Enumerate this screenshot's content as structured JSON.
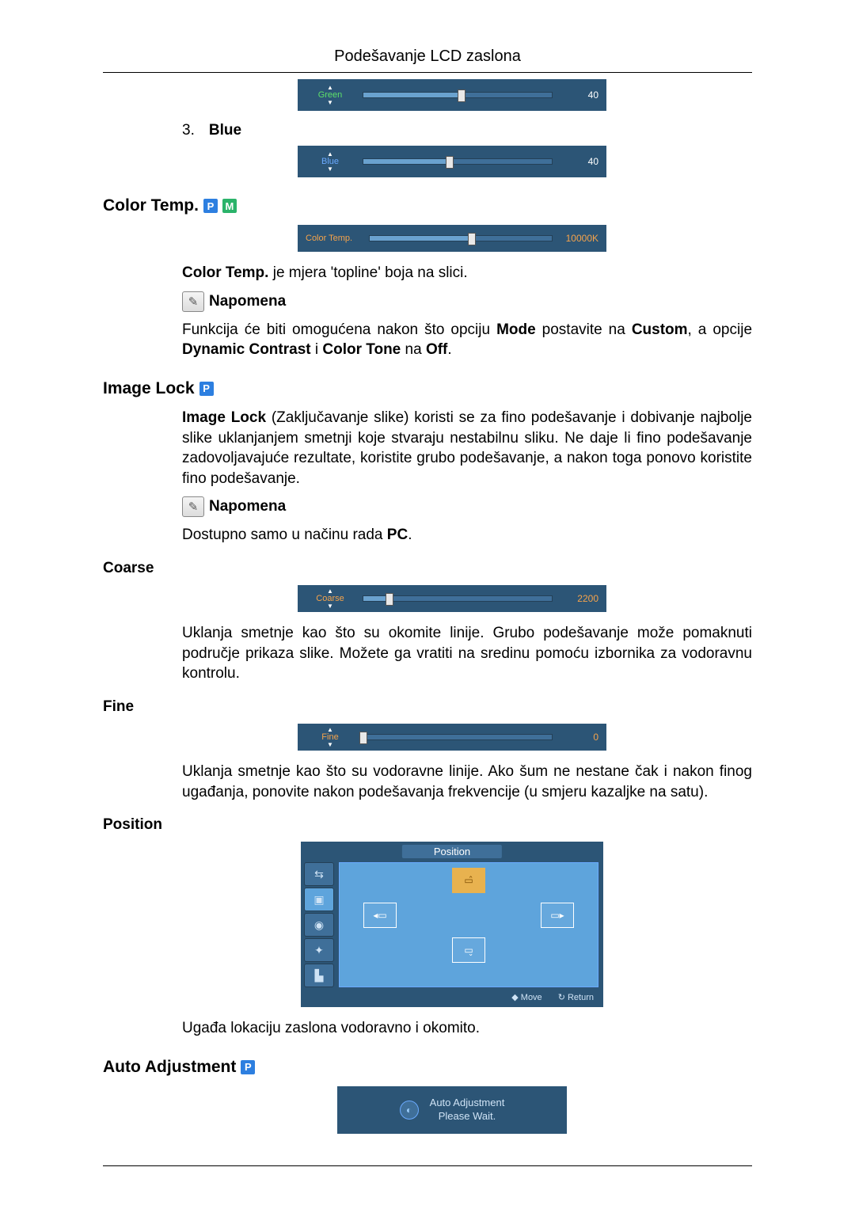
{
  "header": {
    "title": "Podešavanje LCD zaslona"
  },
  "green_slider": {
    "label": "Green",
    "value": "40",
    "percent": 52
  },
  "blue_item": {
    "num": "3.",
    "label": "Blue"
  },
  "blue_slider": {
    "label": "Blue",
    "value": "40",
    "percent": 46
  },
  "color_temp": {
    "heading": "Color Temp.",
    "slider": {
      "label": "Color Temp.",
      "value": "10000K",
      "percent": 56
    },
    "desc_prefix": "Color Temp.",
    "desc_rest": " je mjera 'topline' boja na slici.",
    "note_label": "Napomena",
    "note_text_a": "Funkcija će biti omogućena nakon što opciju ",
    "note_b1": "Mode",
    "note_mid1": " postavite na ",
    "note_b2": "Custom",
    "note_mid2": ", a opcije ",
    "note_b3": "Dynamic Contrast",
    "note_mid3": " i ",
    "note_b4": "Color Tone",
    "note_mid4": " na ",
    "note_b5": "Off",
    "note_end": "."
  },
  "image_lock": {
    "heading": "Image Lock",
    "desc_b": "Image Lock",
    "desc_rest": " (Zaključavanje slike) koristi se za fino podešavanje i dobivanje najbolje slike uklanjanjem smetnji koje stvaraju nestabilnu sliku. Ne daje li fino podešavanje zadovoljavajuće rezultate, koristite grubo podešavanje, a nakon toga ponovo koristite fino podešavanje.",
    "note_label": "Napomena",
    "note_text_a": "Dostupno samo u načinu rada ",
    "note_b1": "PC",
    "note_end": "."
  },
  "coarse": {
    "heading": "Coarse",
    "slider": {
      "label": "Coarse",
      "value": "2200",
      "percent": 14
    },
    "desc": "Uklanja smetnje kao što su okomite linije. Grubo podešavanje može pomaknuti područje prikaza slike. Možete ga vratiti na sredinu pomoću izbornika za vodoravnu kontrolu."
  },
  "fine": {
    "heading": "Fine",
    "slider": {
      "label": "Fine",
      "value": "0",
      "percent": 0
    },
    "desc": "Uklanja smetnje kao što su vodoravne linije. Ako šum ne nestane čak i nakon finog ugađanja, ponovite nakon podešavanja frekvencije (u smjeru kazaljke na satu)."
  },
  "position": {
    "heading": "Position",
    "panel_title": "Position",
    "footer_move": "Move",
    "footer_return": "Return",
    "desc": "Ugađa lokaciju zaslona vodoravno i okomito."
  },
  "auto_adj": {
    "heading": "Auto Adjustment",
    "line1": "Auto Adjustment",
    "line2": "Please Wait."
  },
  "badges": {
    "p": "P",
    "m": "M"
  }
}
